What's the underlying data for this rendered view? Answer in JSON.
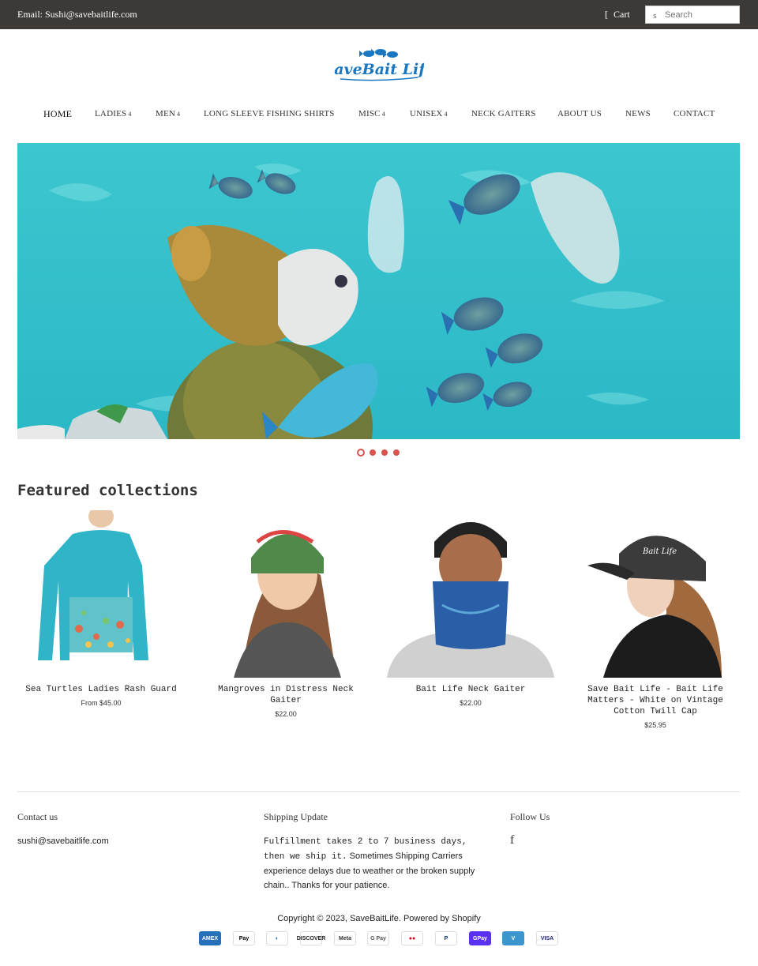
{
  "topbar": {
    "email": "Email: Sushi@savebaitlife.com",
    "cart_label": "Cart",
    "search_placeholder": "Search"
  },
  "brand": {
    "logo_text": "SaveBait Life",
    "accent": "#1a78c2"
  },
  "nav": {
    "items": [
      {
        "label": "HOME",
        "caret": ""
      },
      {
        "label": "LADIES",
        "caret": "4"
      },
      {
        "label": "MEN",
        "caret": "4"
      },
      {
        "label": "LONG SLEEVE FISHING SHIRTS",
        "caret": ""
      },
      {
        "label": "MISC",
        "caret": "4"
      },
      {
        "label": "UNISEX",
        "caret": "4"
      },
      {
        "label": "NECK GAITERS",
        "caret": ""
      },
      {
        "label": "ABOUT US",
        "caret": ""
      },
      {
        "label": "NEWS",
        "caret": ""
      },
      {
        "label": "CONTACT",
        "caret": ""
      }
    ]
  },
  "slider": {
    "slide_count": 4,
    "active_index": 0,
    "dot_color": "#d9534f"
  },
  "featured": {
    "title": "Featured collections",
    "products": [
      {
        "name": "Sea Turtles Ladies Rash Guard",
        "price": "From $45.00"
      },
      {
        "name": "Mangroves in Distress Neck Gaiter",
        "price": "$22.00"
      },
      {
        "name": "Bait Life Neck Gaiter",
        "price": "$22.00"
      },
      {
        "name": "Save Bait Life - Bait Life Matters - White on Vintage Cotton Twill Cap",
        "price": "$25.95"
      }
    ]
  },
  "footer": {
    "contact": {
      "title": "Contact us",
      "email": "sushi@savebaitlife.com"
    },
    "shipping": {
      "title": "Shipping Update",
      "text_mono": "Fulfillment takes 2 to 7 business days, then we ship it.",
      "text_sans": " Sometimes Shipping Carriers experience delays due to weather or the broken supply chain.. Thanks for your patience."
    },
    "follow": {
      "title": "Follow Us",
      "facebook_icon": "facebook-icon",
      "facebook_glyph": "f"
    },
    "copyright": "Copyright © 2023, SaveBaitLife. Powered by Shopify",
    "payments": [
      {
        "label": "AMEX",
        "bg": "#2671b9",
        "fg": "#ffffff"
      },
      {
        "label": "Pay",
        "bg": "#ffffff",
        "fg": "#000000"
      },
      {
        "label": "◐",
        "bg": "#ffffff",
        "fg": "#0b5fa6"
      },
      {
        "label": "DISCOVER",
        "bg": "#ffffff",
        "fg": "#222222"
      },
      {
        "label": "Meta",
        "bg": "#ffffff",
        "fg": "#333333"
      },
      {
        "label": "G Pay",
        "bg": "#ffffff",
        "fg": "#555555"
      },
      {
        "label": "●●",
        "bg": "#ffffff",
        "fg": "#eb001b"
      },
      {
        "label": "P",
        "bg": "#ffffff",
        "fg": "#003087"
      },
      {
        "label": "GPay",
        "bg": "#5a31f4",
        "fg": "#ffffff"
      },
      {
        "label": "V",
        "bg": "#3d95ce",
        "fg": "#ffffff"
      },
      {
        "label": "VISA",
        "bg": "#ffffff",
        "fg": "#1a1f71"
      }
    ]
  }
}
